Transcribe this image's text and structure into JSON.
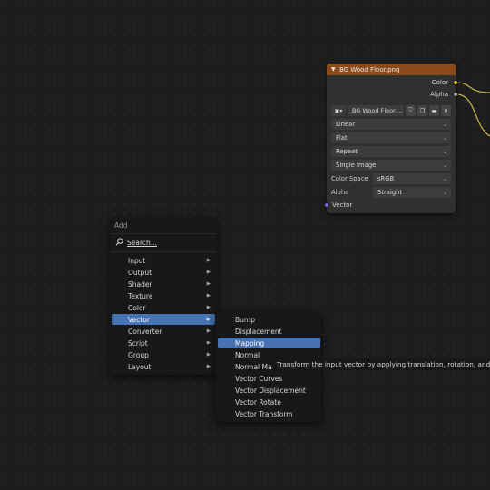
{
  "node": {
    "title": "BG Wood Floor.png",
    "outputs": [
      "Color",
      "Alpha"
    ],
    "image_name": "BG Wood Floor....",
    "interpolation": "Linear",
    "projection": "Flat",
    "extension": "Repeat",
    "source": "Single Image",
    "color_space_label": "Color Space",
    "color_space_value": "sRGB",
    "alpha_label": "Alpha",
    "alpha_value": "Straight",
    "input_vector": "Vector",
    "colors": {
      "header": "#8a4a1c",
      "socket_color": "#e8c61a",
      "socket_alpha": "#a0a0a0",
      "socket_vector": "#6b66d8",
      "link": "#c9b842"
    }
  },
  "add_menu": {
    "title": "Add",
    "search_label": "Search...",
    "items": [
      {
        "label": "Input"
      },
      {
        "label": "Output"
      },
      {
        "label": "Shader"
      },
      {
        "label": "Texture"
      },
      {
        "label": "Color"
      },
      {
        "label": "Vector"
      },
      {
        "label": "Converter"
      },
      {
        "label": "Script"
      },
      {
        "label": "Group"
      },
      {
        "label": "Layout"
      }
    ],
    "active": "Vector",
    "accent": "#4772b3"
  },
  "vector_submenu": {
    "items": [
      {
        "label": "Bump"
      },
      {
        "label": "Displacement"
      },
      {
        "label": "Mapping"
      },
      {
        "label": "Normal"
      },
      {
        "label": "Normal Ma"
      },
      {
        "label": "Vector Curves"
      },
      {
        "label": "Vector Displacement"
      },
      {
        "label": "Vector Rotate"
      },
      {
        "label": "Vector Transform"
      }
    ],
    "active": "Mapping"
  },
  "tooltip": {
    "text": "Transform the input vector by applying translation, rotation, and sc"
  }
}
